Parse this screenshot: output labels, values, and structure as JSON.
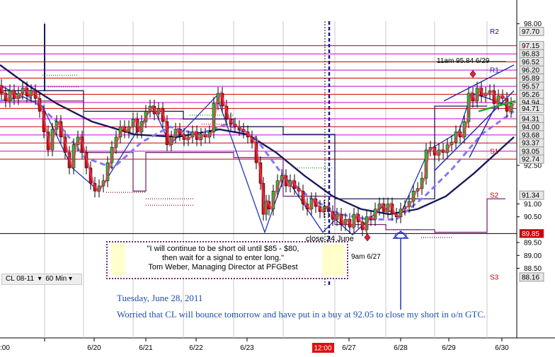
{
  "chart_data": {
    "type": "candlestick",
    "symbol": "CL 08-11",
    "interval": "60 Min",
    "x_labels": [
      "6/20",
      "6/21",
      "6/22",
      "6/23",
      "6/27",
      "6/28",
      "6/29",
      "6/30"
    ],
    "x_partial_label": ":00",
    "x_time_marker": "12:00",
    "ylim": [
      87.8,
      98.1
    ],
    "y_ticks": [
      98.0,
      92.5,
      91.0,
      90.5,
      89.5,
      89.0,
      88.5
    ],
    "price_tags": [
      97.7,
      97.15,
      96.83,
      96.52,
      96.2,
      95.89,
      95.57,
      95.26,
      94.94,
      94.71,
      94.31,
      94.0,
      93.68,
      93.37,
      93.05,
      92.74,
      91.34,
      89.85,
      88.16
    ],
    "last_price": 89.85,
    "pivot_labels": [
      {
        "label": "R2",
        "value": 97.7
      },
      {
        "label": "R1",
        "value": 96.2
      },
      {
        "label": "S1",
        "value": 93.05
      },
      {
        "label": "S2",
        "value": 91.34
      },
      {
        "label": "S3",
        "value": 88.16
      }
    ],
    "horizontal_levels": [
      {
        "value": 97.15,
        "color": "#cc0000"
      },
      {
        "value": 96.83,
        "color": "#cc00cc"
      },
      {
        "value": 96.52,
        "color": "#cc0000"
      },
      {
        "value": 96.2,
        "color": "#cc00cc"
      },
      {
        "value": 95.89,
        "color": "#cc0000"
      },
      {
        "value": 95.57,
        "color": "#cc00cc"
      },
      {
        "value": 95.26,
        "color": "#cc0000"
      },
      {
        "value": 94.94,
        "color": "#cc00cc"
      },
      {
        "value": 94.71,
        "color": "#cc0000"
      },
      {
        "value": 94.31,
        "color": "#cc00cc"
      },
      {
        "value": 94.0,
        "color": "#cc0000"
      },
      {
        "value": 93.68,
        "color": "#cc00cc"
      },
      {
        "value": 93.37,
        "color": "#cc0000"
      },
      {
        "value": 93.05,
        "color": "#cc00cc"
      },
      {
        "value": 92.74,
        "color": "#cc0000"
      }
    ],
    "price_path": [
      [
        0,
        95.6
      ],
      [
        6,
        95.3
      ],
      [
        12,
        95.0
      ],
      [
        18,
        95.4
      ],
      [
        24,
        95.1
      ],
      [
        30,
        95.3
      ],
      [
        36,
        95.5
      ],
      [
        42,
        95.2
      ],
      [
        48,
        95.4
      ],
      [
        54,
        95.1
      ],
      [
        60,
        94.6
      ],
      [
        66,
        93.8
      ],
      [
        72,
        93.1
      ],
      [
        78,
        93.9
      ],
      [
        84,
        94.2
      ],
      [
        90,
        93.6
      ],
      [
        96,
        93.0
      ],
      [
        102,
        92.4
      ],
      [
        108,
        93.3
      ],
      [
        114,
        93.6
      ],
      [
        120,
        93.0
      ],
      [
        126,
        92.4
      ],
      [
        132,
        91.8
      ],
      [
        138,
        91.5
      ],
      [
        144,
        91.7
      ],
      [
        150,
        91.9
      ],
      [
        156,
        92.6
      ],
      [
        162,
        93.2
      ],
      [
        168,
        93.6
      ],
      [
        174,
        94.0
      ],
      [
        180,
        93.8
      ],
      [
        186,
        94.0
      ],
      [
        192,
        94.3
      ],
      [
        198,
        93.8
      ],
      [
        204,
        94.2
      ],
      [
        210,
        94.6
      ],
      [
        216,
        94.8
      ],
      [
        222,
        94.5
      ],
      [
        228,
        94.7
      ],
      [
        234,
        94.2
      ],
      [
        240,
        93.3
      ],
      [
        246,
        93.6
      ],
      [
        252,
        93.9
      ],
      [
        258,
        93.7
      ],
      [
        264,
        93.5
      ],
      [
        270,
        93.6
      ],
      [
        276,
        93.8
      ],
      [
        282,
        93.5
      ],
      [
        288,
        93.7
      ],
      [
        294,
        93.6
      ],
      [
        300,
        93.8
      ],
      [
        306,
        94.9
      ],
      [
        312,
        95.3
      ],
      [
        318,
        94.8
      ],
      [
        324,
        94.3
      ],
      [
        330,
        94.1
      ],
      [
        336,
        94.0
      ],
      [
        342,
        93.9
      ],
      [
        348,
        93.8
      ],
      [
        354,
        93.6
      ],
      [
        360,
        93.4
      ],
      [
        366,
        92.6
      ],
      [
        370,
        91.8
      ],
      [
        374,
        90.6
      ],
      [
        378,
        91.1
      ],
      [
        384,
        90.8
      ],
      [
        390,
        91.5
      ],
      [
        396,
        91.9
      ],
      [
        402,
        92.1
      ],
      [
        408,
        91.7
      ],
      [
        414,
        91.9
      ],
      [
        420,
        91.6
      ],
      [
        426,
        91.5
      ],
      [
        432,
        91.0
      ],
      [
        438,
        90.8
      ],
      [
        444,
        91.2
      ],
      [
        450,
        90.9
      ],
      [
        456,
        90.7
      ],
      [
        462,
        90.9
      ],
      [
        468,
        90.7
      ],
      [
        474,
        90.4
      ],
      [
        480,
        90.6
      ],
      [
        486,
        90.2
      ],
      [
        492,
        90.4
      ],
      [
        498,
        90.1
      ],
      [
        504,
        90.6
      ],
      [
        510,
        90.3
      ],
      [
        516,
        90.0
      ],
      [
        522,
        90.5
      ],
      [
        528,
        90.4
      ],
      [
        534,
        90.8
      ],
      [
        540,
        91.0
      ],
      [
        546,
        90.7
      ],
      [
        552,
        91.0
      ],
      [
        558,
        90.6
      ],
      [
        564,
        90.5
      ],
      [
        570,
        90.8
      ],
      [
        576,
        90.9
      ],
      [
        582,
        91.1
      ],
      [
        588,
        91.5
      ],
      [
        594,
        91.6
      ],
      [
        600,
        92.0
      ],
      [
        606,
        93.1
      ],
      [
        612,
        93.2
      ],
      [
        618,
        92.9
      ],
      [
        624,
        93.1
      ],
      [
        630,
        93.0
      ],
      [
        636,
        93.3
      ],
      [
        642,
        93.4
      ],
      [
        648,
        93.8
      ],
      [
        654,
        93.6
      ],
      [
        660,
        94.2
      ],
      [
        666,
        95.3
      ],
      [
        672,
        95.0
      ],
      [
        678,
        95.5
      ],
      [
        684,
        95.2
      ],
      [
        690,
        95.3
      ],
      [
        696,
        95.4
      ],
      [
        702,
        94.9
      ],
      [
        708,
        95.2
      ],
      [
        714,
        95.1
      ],
      [
        720,
        94.6
      ],
      [
        726,
        94.9
      ]
    ],
    "markers": [
      {
        "label": "11am 95.84 6/29",
        "x": 668,
        "value": 96.05
      },
      {
        "label": "9am 6/27",
        "x": 519,
        "value": 89.7
      }
    ],
    "annotations": [
      "close 24 June"
    ]
  },
  "quote": {
    "line1": "\"I will continue to be short oil until $85 - $80,",
    "line2": "then wait for a signal to enter long.\"",
    "line3": "Tom Weber, Managing Director at PFGBest"
  },
  "toolbar": {
    "symbol": "CL 08-11",
    "interval": "60 Min",
    "arrow": "▾"
  },
  "note": {
    "date": "Tuesday, June 28, 2011",
    "text": "Worried that CL will bounce tomorrow and have put in a buy at 92.05 to close my short in o/n GTC."
  },
  "colors": {
    "red_levels": "#cc0000",
    "magenta_levels": "#cc00cc",
    "navy_ma": "#1a1a5e",
    "blue_trend": "#2233bb",
    "dashed_ma": "#8877ee",
    "red_ma": "#ee3355",
    "last_price_tag": "#cc0000",
    "note_text": "#1e4faa"
  }
}
